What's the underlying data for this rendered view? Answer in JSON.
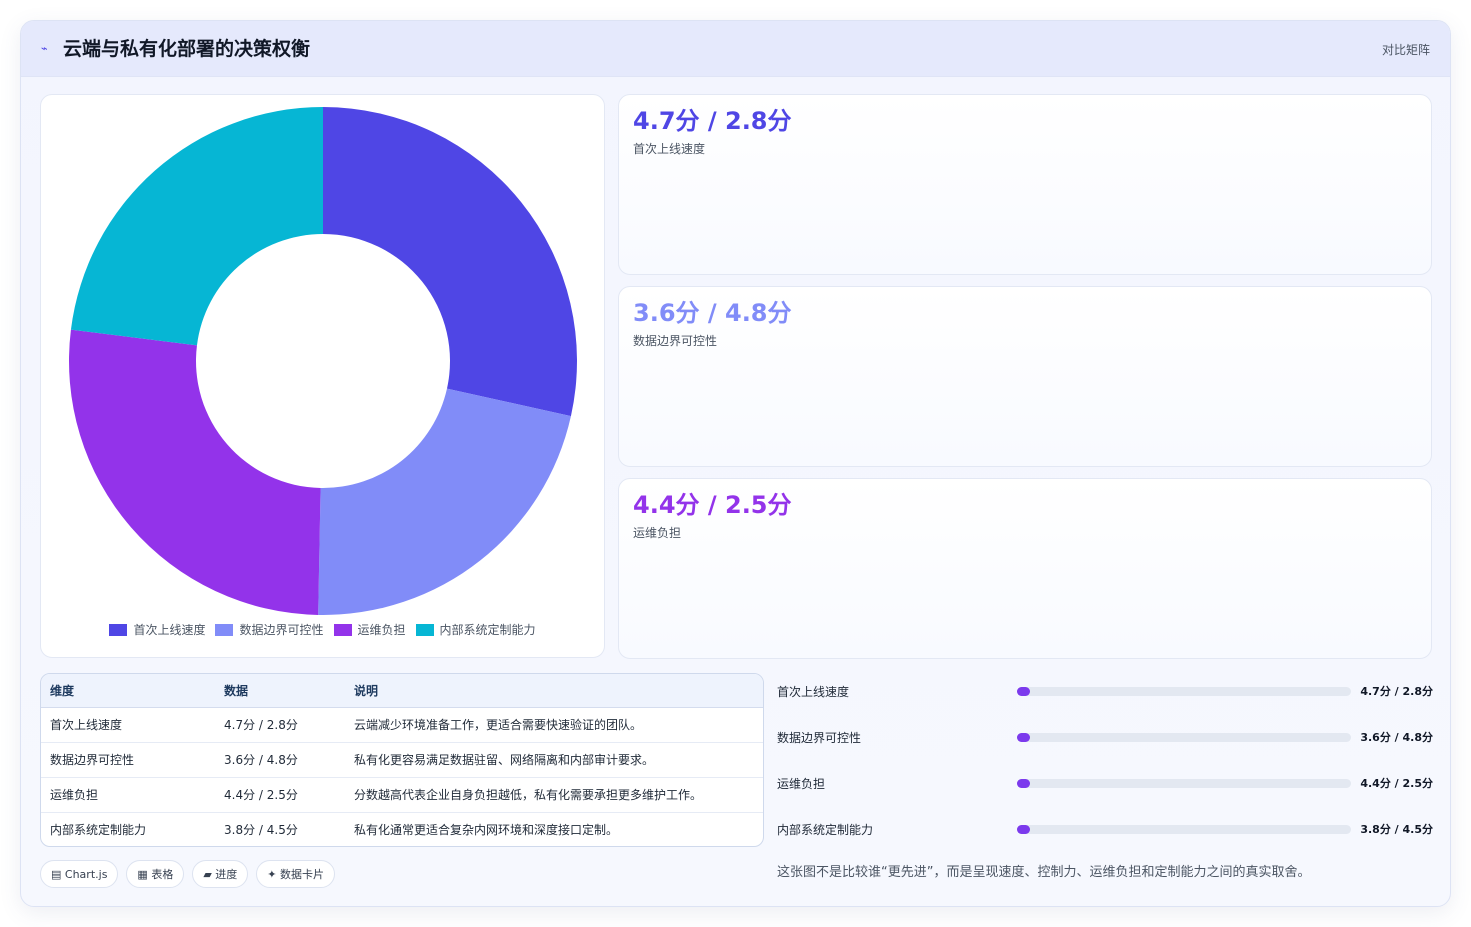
{
  "header": {
    "icon": "chart-line-icon",
    "title": "云端与私有化部署的决策权衡",
    "right_label": "对比矩阵"
  },
  "chart_data": {
    "type": "pie",
    "title": "",
    "categories": [
      "首次上线速度",
      "数据边界可控性",
      "运维负担",
      "内部系统定制能力"
    ],
    "values": [
      4.7,
      3.6,
      4.4,
      3.8
    ],
    "colors": [
      "#4f46e5",
      "#818cf8",
      "#9333ea",
      "#06b6d4"
    ],
    "legend_position": "bottom"
  },
  "stats": [
    {
      "value": "4.7分 / 2.8分",
      "label": "首次上线速度",
      "color": "#4f46e5"
    },
    {
      "value": "3.6分 / 4.8分",
      "label": "数据边界可控性",
      "color": "#818cf8"
    },
    {
      "value": "4.4分 / 2.5分",
      "label": "运维负担",
      "color": "#9333ea"
    }
  ],
  "table": {
    "headers": [
      "维度",
      "数据",
      "说明"
    ],
    "rows": [
      [
        "首次上线速度",
        "4.7分 / 2.8分",
        "云端减少环境准备工作，更适合需要快速验证的团队。"
      ],
      [
        "数据边界可控性",
        "3.6分 / 4.8分",
        "私有化更容易满足数据驻留、网络隔离和内部审计要求。"
      ],
      [
        "运维负担",
        "4.4分 / 2.5分",
        "分数越高代表企业自身负担越低，私有化需要承担更多维护工作。"
      ],
      [
        "内部系统定制能力",
        "3.8分 / 4.5分",
        "私有化通常更适合复杂内网环境和深度接口定制。"
      ]
    ]
  },
  "chips": [
    {
      "icon": "chart-icon",
      "glyph": "▤",
      "label": "Chart.js"
    },
    {
      "icon": "table-icon",
      "glyph": "▦",
      "label": "表格"
    },
    {
      "icon": "progress-icon",
      "glyph": "▰",
      "label": "进度"
    },
    {
      "icon": "sparkle-icon",
      "glyph": "✦",
      "label": "数据卡片"
    }
  ],
  "progress": [
    {
      "label": "首次上线速度",
      "value": "4.7分 / 2.8分",
      "fraction": 0.0
    },
    {
      "label": "数据边界可控性",
      "value": "3.6分 / 4.8分",
      "fraction": 0.0
    },
    {
      "label": "运维负担",
      "value": "4.4分 / 2.5分",
      "fraction": 0.0
    },
    {
      "label": "内部系统定制能力",
      "value": "3.8分 / 4.5分",
      "fraction": 0.0
    }
  ],
  "footnote": "这张图不是比较谁“更先进”，而是呈现速度、控制力、运维负担和定制能力之间的真实取舍。"
}
